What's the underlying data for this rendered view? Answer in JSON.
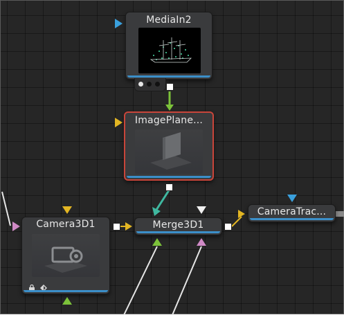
{
  "nodes": {
    "media_in": {
      "title": "MediaIn2",
      "view_dots": [
        "dot1",
        "dot2",
        "dot3"
      ]
    },
    "image_plane": {
      "title": "ImagePlane..."
    },
    "camera": {
      "title": "Camera3D1",
      "footer_icons": [
        "lock-icon",
        "visibility-icon"
      ]
    },
    "merge": {
      "title": "Merge3D1"
    },
    "camera_tracker": {
      "title": "CameraTrac..."
    }
  },
  "colors": {
    "canvas_bg": "#262626",
    "node_bg": "#3a3b3d",
    "node_bar": "#3b8fc9",
    "selected_border": "#c9453a",
    "input_blue": "#3aa0dd",
    "input_yellow": "#e3b623",
    "input_pink": "#d08ac6",
    "input_green": "#7cc23a",
    "wire_green": "#7cc23a",
    "wire_teal": "#3fb8a0"
  }
}
